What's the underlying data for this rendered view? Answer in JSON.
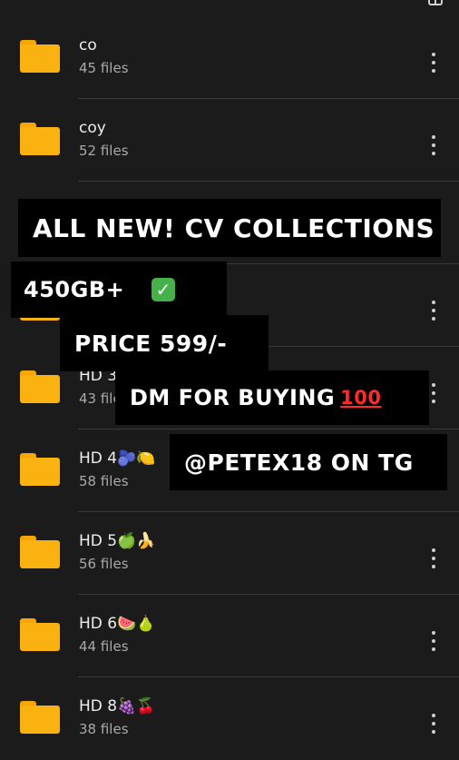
{
  "folders": [
    {
      "name": "co",
      "count": "45 files"
    },
    {
      "name": "coy",
      "count": "52 files"
    },
    {
      "name": "",
      "count": ""
    },
    {
      "name": "",
      "count": ""
    },
    {
      "name": "HD 3",
      "count": "43 files"
    },
    {
      "name": "HD 4🫐🍋",
      "count": "58 files"
    },
    {
      "name": "HD 5🍏🍌",
      "count": "56 files"
    },
    {
      "name": "HD 6🍉🍐",
      "count": "44 files"
    },
    {
      "name": "HD 8🍇🍒",
      "count": "38 files"
    }
  ],
  "overlay": {
    "line1": "ALL NEW! CV COLLECTIONS",
    "line2": "450GB+",
    "line2_check": "✓",
    "line3": "PRICE 599/-",
    "line4": "DM FOR BUYING",
    "line4_emoji": "100",
    "line5": "@PETEX18 ON TG"
  },
  "colors": {
    "background": "#1b1b1b",
    "folder": "#f9b20f",
    "overlay": "#000000"
  }
}
